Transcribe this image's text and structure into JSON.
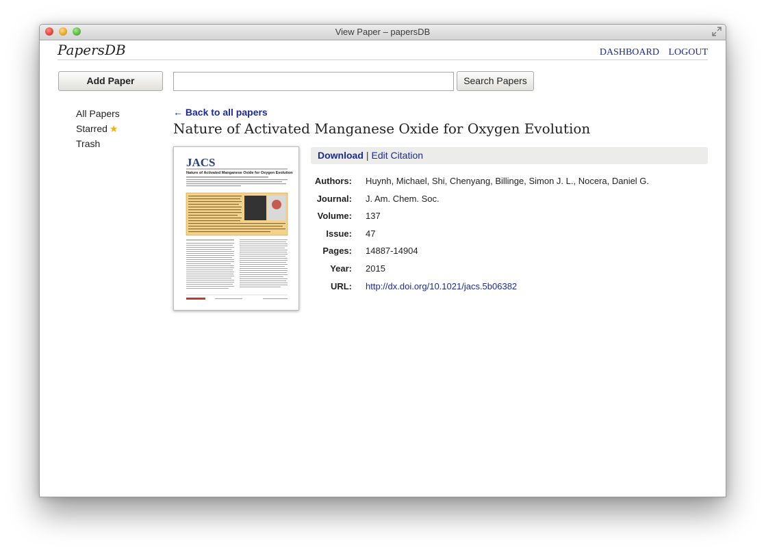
{
  "window": {
    "title": "View Paper – papersDB"
  },
  "app": {
    "logo": "PapersDB"
  },
  "nav": {
    "dashboard": "DASHBOARD",
    "logout": "LOGOUT"
  },
  "toolbar": {
    "add_paper": "Add Paper",
    "search_button": "Search Papers",
    "search_value": ""
  },
  "sidebar": {
    "items": [
      {
        "label": "All Papers"
      },
      {
        "label": "Starred"
      },
      {
        "label": "Trash"
      }
    ]
  },
  "main": {
    "back_link": "← Back to all papers",
    "title": "Nature of Activated Manganese Oxide for Oxygen Evolution",
    "actions": {
      "download": "Download",
      "separator": "|",
      "edit_citation": "Edit Citation"
    },
    "meta": [
      {
        "label": "Authors:",
        "value": "Huynh, Michael, Shi, Chenyang, Billinge, Simon J. L., Nocera, Daniel G."
      },
      {
        "label": "Journal:",
        "value": "J. Am. Chem. Soc."
      },
      {
        "label": "Volume:",
        "value": "137"
      },
      {
        "label": "Issue:",
        "value": "47"
      },
      {
        "label": "Pages:",
        "value": "14887-14904"
      },
      {
        "label": "Year:",
        "value": "2015"
      },
      {
        "label": "URL:",
        "value": "http://dx.doi.org/10.1021/jacs.5b06382"
      }
    ],
    "thumbnail": {
      "journal_logo": "JACS",
      "paper_title": "Nature of Activated Manganese Oxide for Oxygen Evolution"
    }
  },
  "colors": {
    "link": "#1a2a9a",
    "star": "#f0b400",
    "abstract_highlight": "#f3d28c"
  }
}
